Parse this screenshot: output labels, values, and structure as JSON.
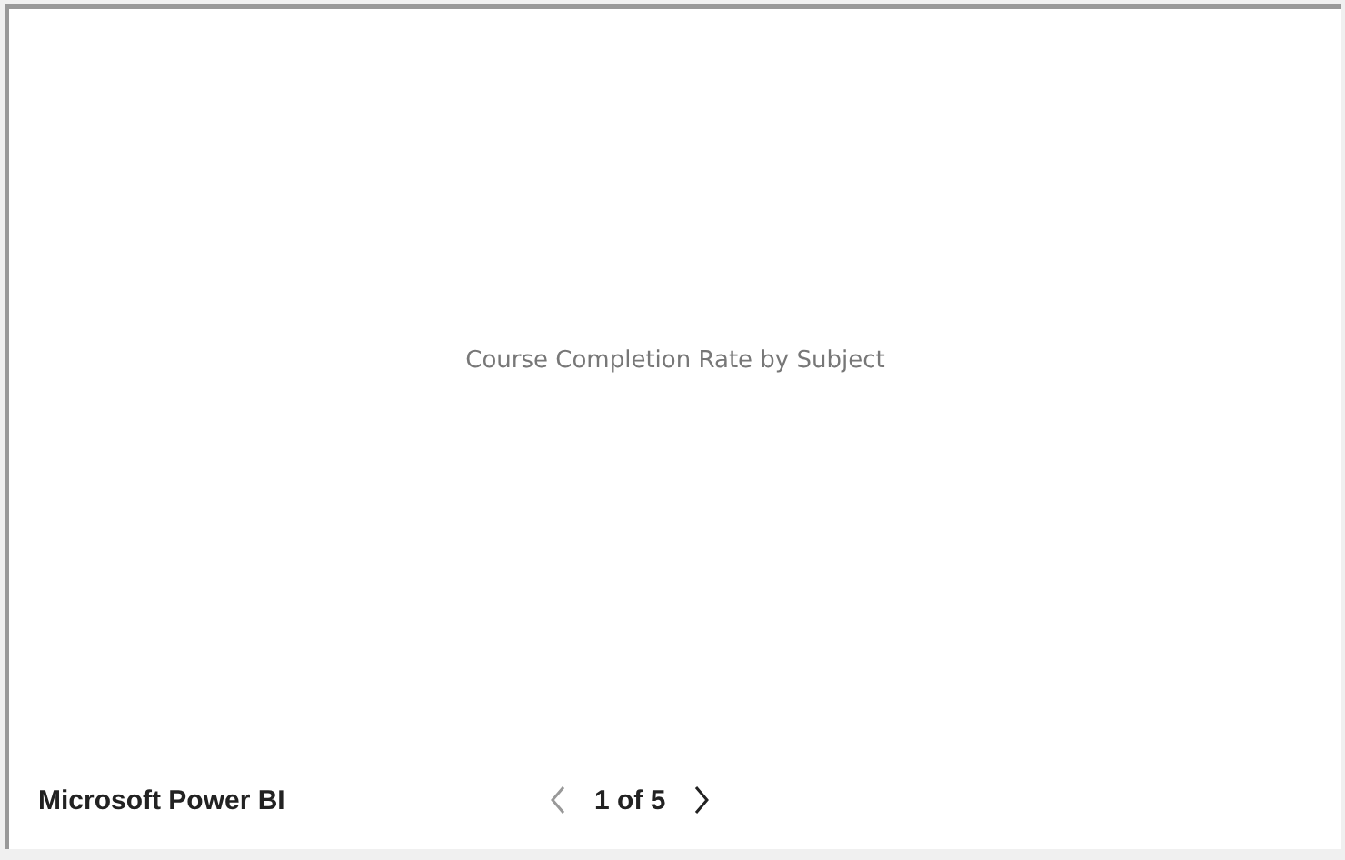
{
  "report": {
    "placeholder_title": "Course Completion Rate by Subject"
  },
  "footer": {
    "brand": "Microsoft Power BI",
    "pager": {
      "previous": {
        "disabled": true
      },
      "page": "1 of 5",
      "next": {
        "disabled": false
      }
    }
  }
}
